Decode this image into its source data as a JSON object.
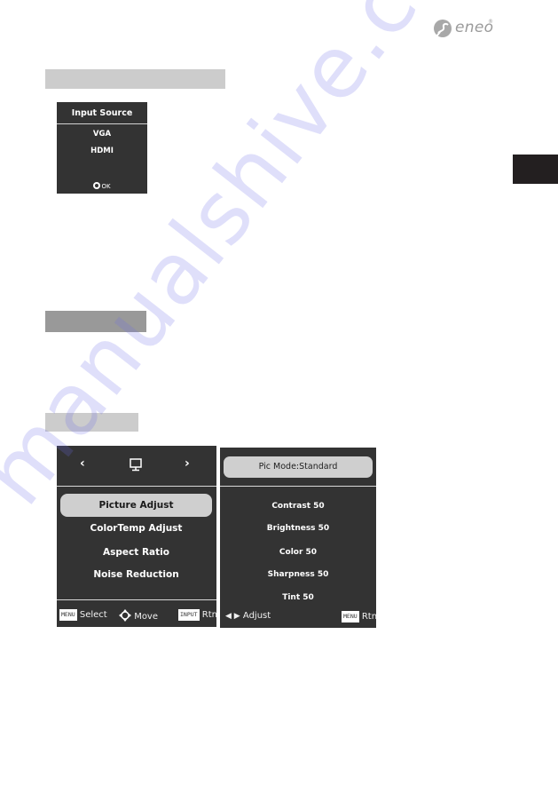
{
  "logo": {
    "text": "eneo",
    "mark": "®",
    "icon": "eneo-globe-logo"
  },
  "sections": [
    {
      "id": "input-source",
      "bar_color": "#cccccc"
    },
    {
      "id": "section-2",
      "bar_color": "#999999"
    },
    {
      "id": "section-3",
      "bar_color": "#cccccc"
    }
  ],
  "side_tab_color": "#231f20",
  "input_source": {
    "title": "Input Source",
    "options": [
      "VGA",
      "HDMI"
    ],
    "ok_label": "OK"
  },
  "main_menu": {
    "prev_arrow": "‹",
    "next_arrow": "›",
    "category_icon": "monitor-icon",
    "items": [
      {
        "label": "Picture Adjust",
        "selected": true
      },
      {
        "label": "ColorTemp Adjust",
        "selected": false
      },
      {
        "label": "Aspect Ratio",
        "selected": false
      },
      {
        "label": "Noise Reduction",
        "selected": false
      }
    ],
    "footer": {
      "select_key": "MENU",
      "select_label": "Select",
      "move_label": "Move",
      "return_key": "INPUT",
      "return_label": "Rtn"
    }
  },
  "picture_adjust": {
    "mode_label": "Pic Mode:Standard",
    "settings": [
      {
        "label": "Contrast",
        "value": 50,
        "text": "Contrast 50"
      },
      {
        "label": "Brightness",
        "value": 50,
        "text": "Brightness 50"
      },
      {
        "label": "Color",
        "value": 50,
        "text": "Color 50"
      },
      {
        "label": "Sharpness",
        "value": 50,
        "text": "Sharpness 50"
      },
      {
        "label": "Tint",
        "value": 50,
        "text": "Tint 50"
      }
    ],
    "footer": {
      "adjust_label": "Adjust",
      "return_key": "MENU",
      "return_label": "Rtn"
    }
  },
  "watermark": "manualshive.com"
}
